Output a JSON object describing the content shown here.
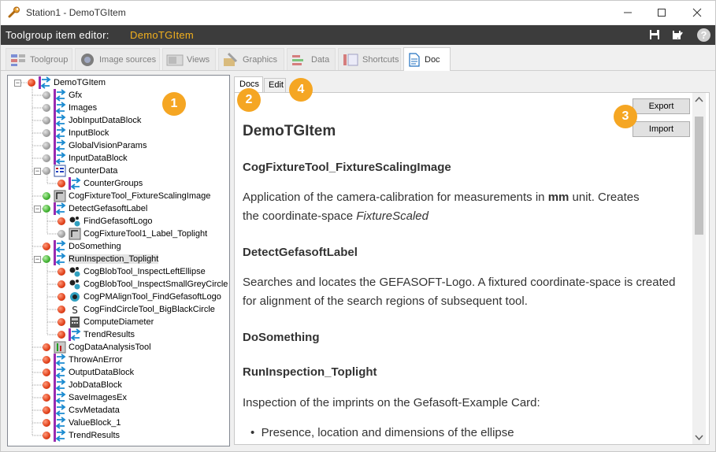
{
  "window": {
    "title": "Station1 - DemoTGItem"
  },
  "header": {
    "label": "Toolgroup item editor:",
    "item_name": "DemoTGItem"
  },
  "tabs": [
    {
      "label": "Toolgroup"
    },
    {
      "label": "Image sources"
    },
    {
      "label": "Views"
    },
    {
      "label": "Graphics"
    },
    {
      "label": "Data"
    },
    {
      "label": "Shortcuts"
    },
    {
      "label": "Doc"
    }
  ],
  "tree": {
    "root": "DemoTGItem",
    "items": [
      {
        "label": "Gfx",
        "status": "gray"
      },
      {
        "label": "Images",
        "status": "gray"
      },
      {
        "label": "JobInputDataBlock",
        "status": "gray"
      },
      {
        "label": "InputBlock",
        "status": "gray"
      },
      {
        "label": "GlobalVisionParams",
        "status": "gray"
      },
      {
        "label": "InputDataBlock",
        "status": "gray"
      },
      {
        "label": "CounterData",
        "status": "gray"
      },
      {
        "label": "CounterGroups",
        "status": "red"
      },
      {
        "label": "CogFixtureTool_FixtureScalingImage",
        "status": "green"
      },
      {
        "label": "DetectGefasoftLabel",
        "status": "green"
      },
      {
        "label": "FindGefasoftLogo",
        "status": "red"
      },
      {
        "label": "CogFixtureTool1_Label_Toplight",
        "status": "gray"
      },
      {
        "label": "DoSomething",
        "status": "red"
      },
      {
        "label": "RunInspection_Toplight",
        "status": "green"
      },
      {
        "label": "CogBlobTool_InspectLeftEllipse",
        "status": "red"
      },
      {
        "label": "CogBlobTool_InspectSmallGreyCircle",
        "status": "red"
      },
      {
        "label": "CogPMAlignTool_FindGefasoftLogo",
        "status": "red"
      },
      {
        "label": "CogFindCircleTool_BigBlackCircle",
        "status": "red"
      },
      {
        "label": "ComputeDiameter",
        "status": "red"
      },
      {
        "label": "TrendResults",
        "status": "red"
      },
      {
        "label": "CogDataAnalysisTool",
        "status": "red"
      },
      {
        "label": "ThrowAnError",
        "status": "red"
      },
      {
        "label": "OutputDataBlock",
        "status": "red"
      },
      {
        "label": "JobDataBlock",
        "status": "red"
      },
      {
        "label": "SaveImagesEx",
        "status": "red"
      },
      {
        "label": "CsvMetadata",
        "status": "red"
      },
      {
        "label": "ValueBlock_1",
        "status": "red"
      },
      {
        "label": "TrendResults",
        "status": "red"
      }
    ]
  },
  "doc": {
    "subtabs": [
      "Docs",
      "Edit"
    ],
    "export_label": "Export",
    "import_label": "Import",
    "title": "DemoTGItem",
    "s1_heading": "CogFixtureTool_FixtureScalingImage",
    "s1_text_a": "Application of the camera-calibration for measurements in ",
    "s1_text_bold": "mm",
    "s1_text_b": " unit. Creates",
    "s1_text_c": "the coordinate-space ",
    "s1_text_italic": "FixtureScaled",
    "s2_heading": "DetectGefasoftLabel",
    "s2_text": "Searches and locates the GEFASOFT-Logo. A fixtured coordinate-space is created for alignment of the search regions of subsequent tool.",
    "s3_heading": "DoSomething",
    "s4_heading": "RunInspection_Toplight",
    "s4_text": "Inspection of the imprints on the Gefasoft-Example Card:",
    "s4_bullet": "Presence, location and dimensions of the ellipse"
  },
  "callouts": [
    "1",
    "2",
    "3",
    "4"
  ],
  "colors": {
    "accent_orange": "#f5a623",
    "header_bg": "#3c3c3c",
    "header_item": "#f2b01e"
  }
}
